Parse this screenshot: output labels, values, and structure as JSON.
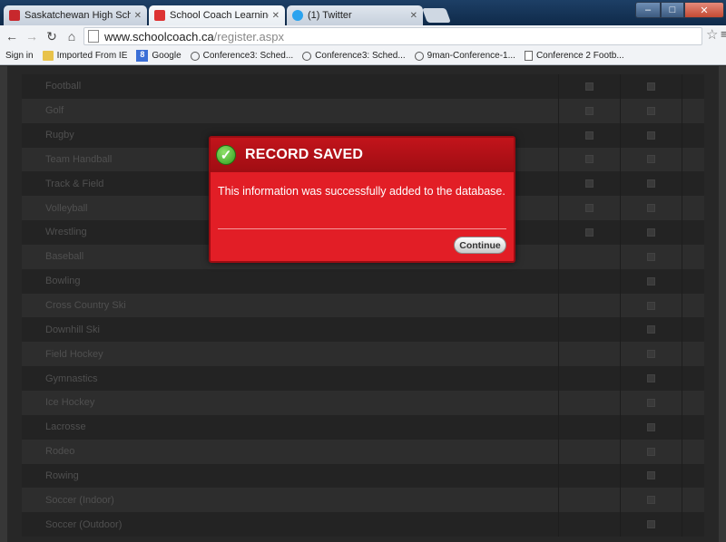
{
  "browser": {
    "tabs": [
      {
        "title": "Saskatchewan High Schoo",
        "active": false
      },
      {
        "title": "School Coach Learning C",
        "active": true
      },
      {
        "title": "(1) Twitter",
        "active": false
      }
    ],
    "url_host": "www.schoolcoach.ca",
    "url_path": "/register.aspx",
    "bookmarks": [
      {
        "label": "Sign in",
        "icon": "none"
      },
      {
        "label": "Imported From IE",
        "icon": "folder-icon"
      },
      {
        "label": "Google",
        "icon": "google-icon"
      },
      {
        "label": "Conference3: Sched...",
        "icon": "globe-icon"
      },
      {
        "label": "Conference3: Sched...",
        "icon": "globe-icon"
      },
      {
        "label": "9man-Conference-1...",
        "icon": "globe-icon"
      },
      {
        "label": "Conference 2 Footb...",
        "icon": "doc-icon"
      }
    ]
  },
  "sports": [
    {
      "name": "Football",
      "col1": true,
      "col2": true
    },
    {
      "name": "Golf",
      "col1": true,
      "col2": true
    },
    {
      "name": "Rugby",
      "col1": true,
      "col2": true
    },
    {
      "name": "Team Handball",
      "col1": true,
      "col2": true
    },
    {
      "name": "Track & Field",
      "col1": true,
      "col2": true
    },
    {
      "name": "Volleyball",
      "col1": true,
      "col2": true
    },
    {
      "name": "Wrestling",
      "col1": true,
      "col2": true
    },
    {
      "name": "Baseball",
      "col1": false,
      "col2": true
    },
    {
      "name": "Bowling",
      "col1": false,
      "col2": true
    },
    {
      "name": "Cross Country Ski",
      "col1": false,
      "col2": true
    },
    {
      "name": "Downhill Ski",
      "col1": false,
      "col2": true
    },
    {
      "name": "Field Hockey",
      "col1": false,
      "col2": true
    },
    {
      "name": "Gymnastics",
      "col1": false,
      "col2": true
    },
    {
      "name": "Ice Hockey",
      "col1": false,
      "col2": true
    },
    {
      "name": "Lacrosse",
      "col1": false,
      "col2": true
    },
    {
      "name": "Rodeo",
      "col1": false,
      "col2": true
    },
    {
      "name": "Rowing",
      "col1": false,
      "col2": true
    },
    {
      "name": "Soccer (Indoor)",
      "col1": false,
      "col2": true
    },
    {
      "name": "Soccer (Outdoor)",
      "col1": false,
      "col2": true
    }
  ],
  "modal": {
    "title": "RECORD SAVED",
    "message": "This information was successfully added to the database.",
    "button": "Continue"
  }
}
